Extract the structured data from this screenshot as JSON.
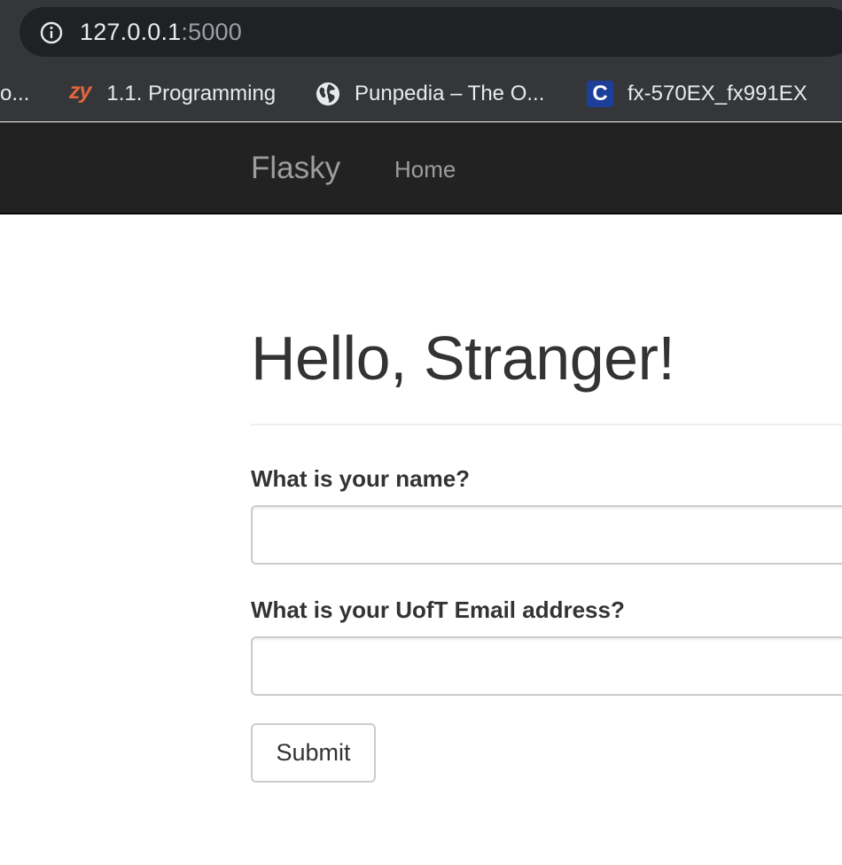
{
  "browser": {
    "url_host": "127.0.0.1",
    "url_port": ":5000",
    "info_icon": "info-icon"
  },
  "bookmarks": [
    {
      "label": "ro...",
      "icon": "none"
    },
    {
      "label": "1.1. Programming",
      "icon": "zybooks-icon",
      "icon_text": "zy"
    },
    {
      "label": "Punpedia – The O...",
      "icon": "globe-icon"
    },
    {
      "label": "fx-570EX_fx991EX",
      "icon": "casio-c-icon",
      "icon_text": "C"
    }
  ],
  "navbar": {
    "brand": "Flasky",
    "links": [
      "Home"
    ]
  },
  "page": {
    "title": "Hello, Stranger!"
  },
  "form": {
    "name_label": "What is your name?",
    "name_value": "",
    "email_label": "What is your UofT Email address?",
    "email_value": "",
    "submit_label": "Submit"
  },
  "colors": {
    "chrome_bg": "#35363a",
    "omnibox_bg": "#202124",
    "navbar_bg": "#222222",
    "navbar_text": "#9d9d9d",
    "text": "#333333",
    "zy_icon": "#e0663b",
    "casio_icon": "#1d3f9a"
  }
}
